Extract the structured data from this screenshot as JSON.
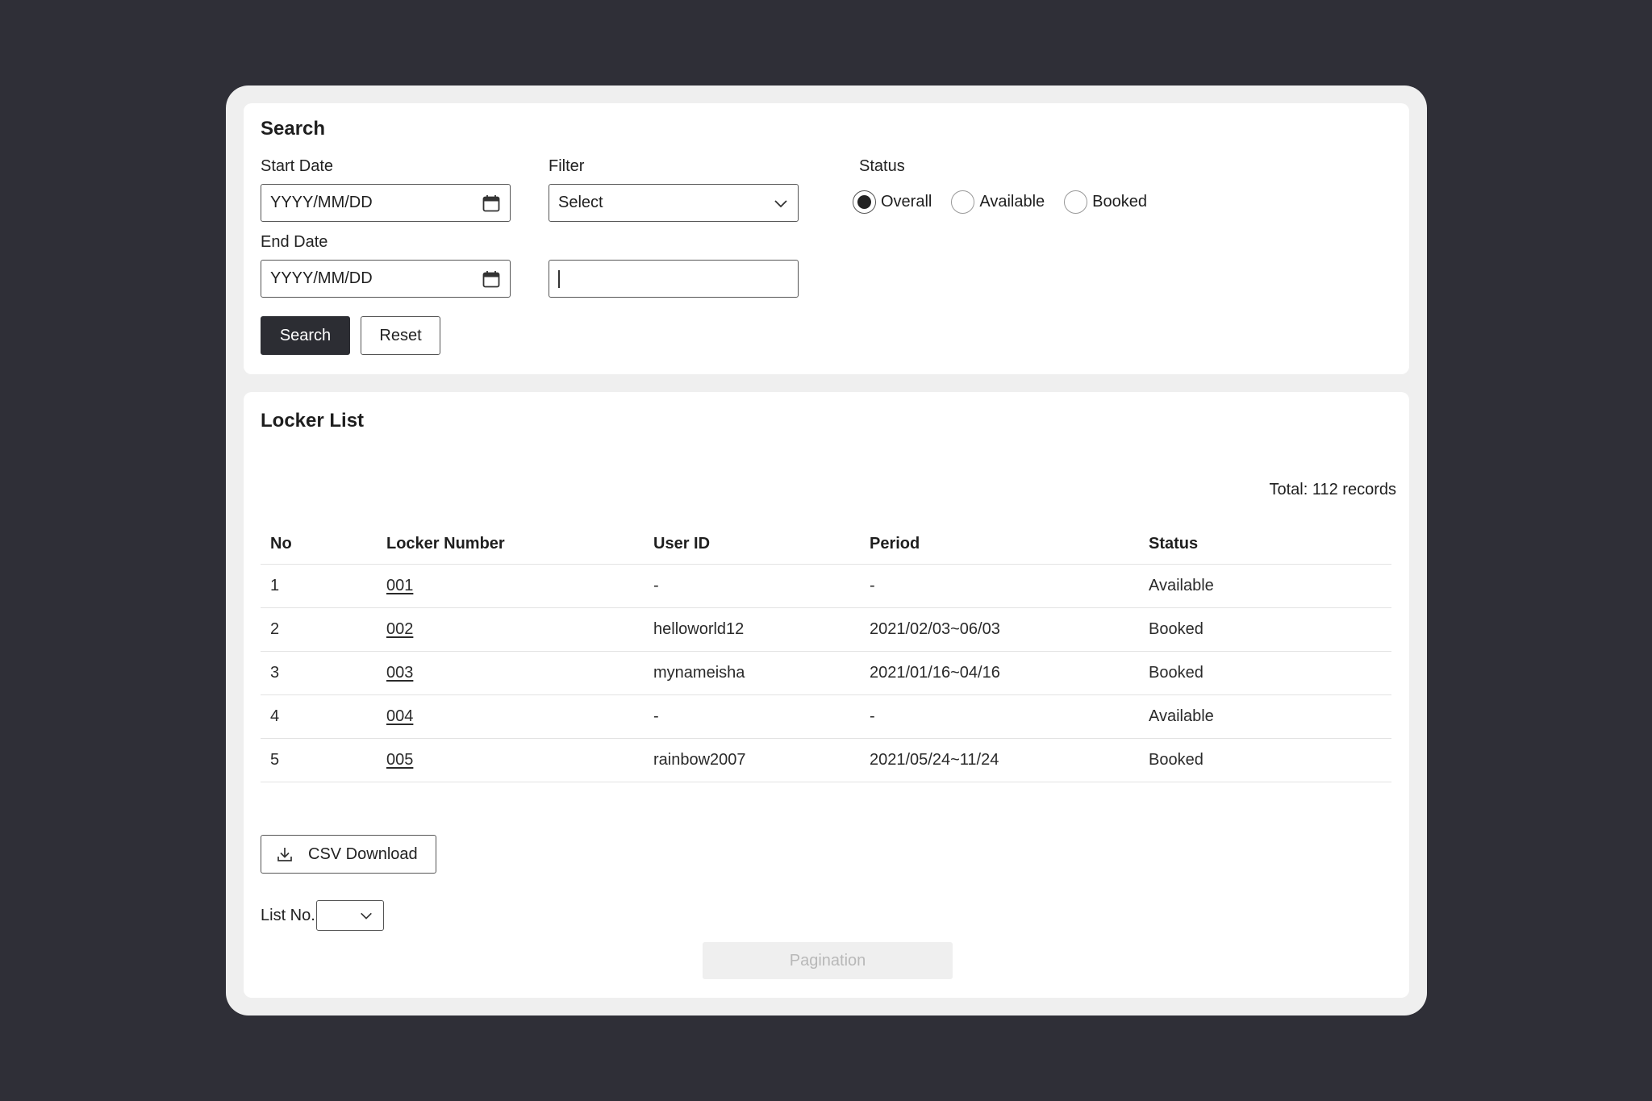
{
  "search": {
    "title": "Search",
    "start_date_label": "Start Date",
    "start_date_placeholder": "YYYY/MM/DD",
    "end_date_label": "End Date",
    "end_date_placeholder": "YYYY/MM/DD",
    "filter_label": "Filter",
    "filter_selected": "Select",
    "filter_text_value": "",
    "status_label": "Status",
    "status_options": [
      "Overall",
      "Available",
      "Booked"
    ],
    "status_selected": "Overall",
    "search_button": "Search",
    "reset_button": "Reset"
  },
  "locker_list": {
    "title": "Locker List",
    "total": "Total: 112 records",
    "columns": [
      "No",
      "Locker Number",
      "User ID",
      "Period",
      "Status"
    ],
    "rows": [
      {
        "no": "1",
        "locker": "001",
        "user": "-",
        "period": "-",
        "status": "Available"
      },
      {
        "no": "2",
        "locker": "002",
        "user": "helloworld12",
        "period": "2021/02/03~06/03",
        "status": "Booked"
      },
      {
        "no": "3",
        "locker": "003",
        "user": "mynameisha",
        "period": "2021/01/16~04/16",
        "status": "Booked"
      },
      {
        "no": "4",
        "locker": "004",
        "user": "-",
        "period": "-",
        "status": "Available"
      },
      {
        "no": "5",
        "locker": "005",
        "user": "rainbow2007",
        "period": "2021/05/24~11/24",
        "status": "Booked"
      }
    ],
    "csv_button": "CSV Download",
    "list_no_label": "List No.",
    "list_no_value": "",
    "pagination_placeholder": "Pagination"
  },
  "icons": {
    "calendar": "calendar-icon",
    "chevron": "chevron-down-icon",
    "download": "download-icon"
  },
  "colors": {
    "background": "#2f2f37",
    "frame": "#efefef",
    "card": "#ffffff",
    "primary_button": "#2c2d33",
    "pagination_bg": "#efefef",
    "pagination_text": "#b8b8b8"
  }
}
